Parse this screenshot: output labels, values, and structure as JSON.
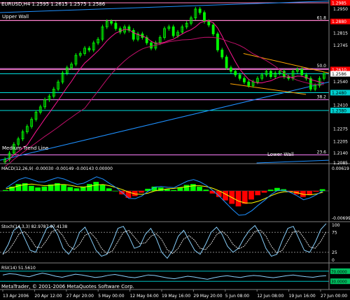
{
  "header": {
    "symbol_line": "EURUSD,H4  1.2595  1.2615  1.2575  1.2586"
  },
  "footer": {
    "copyright": "MetaTrader, © 2001-2006 MetaQuotes Software Corp."
  },
  "colors": {
    "background": "#000000",
    "up_bar": "#00ff00",
    "fib_line": "#ff80ff",
    "channel_line": "#1e90ff",
    "price_badge": "#ff0000",
    "level_badge": "#00d0d0",
    "orange_line": "#ffa500",
    "ma_line": "#ff1493",
    "macd_histogram_up": "#00ff00",
    "macd_histogram_down": "#ff0000",
    "macd_signal": "#ffff00",
    "macd_line": "#1e90ff",
    "stoch_line": "#87cefa",
    "rsi_line": "#87cefa"
  },
  "chart_data": [
    {
      "type": "candlestick",
      "name": "EURUSD,H4",
      "ylim": [
        1.2085,
        1.2985
      ],
      "price_axis_labels": [
        "1.2985",
        "1.2950",
        "1.2880",
        "1.2815",
        "1.2745",
        "1.2610",
        "1.2586",
        "1.2540",
        "1.2480",
        "1.2410",
        "1.2380",
        "1.2275",
        "1.2205",
        "1.2140",
        "1.2085"
      ],
      "highlighted_prices": [
        {
          "value": "1.2985",
          "style": "price"
        },
        {
          "value": "1.2880",
          "style": "price"
        },
        {
          "value": "1.2610",
          "style": "price"
        },
        {
          "value": "1.2586",
          "style": "current"
        },
        {
          "value": "1.2480",
          "style": "level"
        },
        {
          "value": "1.2380",
          "style": "level"
        }
      ],
      "fib_levels": [
        {
          "label": "61.8",
          "price": 1.2885
        },
        {
          "label": "50.0",
          "price": 1.2615
        },
        {
          "label": "38.2",
          "price": 1.244
        },
        {
          "label": "23.6",
          "price": 1.213
        }
      ],
      "horizontal_levels": [
        1.2985,
        1.2886,
        1.261,
        1.2586,
        1.248,
        1.238
      ],
      "annotations": [
        "Upper Wall",
        "Medium Trend Line",
        "Lower Wall"
      ],
      "close_path": [
        1.2105,
        1.214,
        1.219,
        1.222,
        1.226,
        1.229,
        1.233,
        1.237,
        1.24,
        1.244,
        1.246,
        1.25,
        1.254,
        1.259,
        1.262,
        1.264,
        1.269,
        1.27,
        1.273,
        1.272,
        1.276,
        1.278,
        1.285,
        1.288,
        1.287,
        1.284,
        1.282,
        1.285,
        1.283,
        1.278,
        1.281,
        1.279,
        1.276,
        1.273,
        1.276,
        1.279,
        1.284,
        1.285,
        1.28,
        1.282,
        1.285,
        1.287,
        1.29,
        1.295,
        1.293,
        1.288,
        1.286,
        1.281,
        1.272,
        1.268,
        1.262,
        1.26,
        1.258,
        1.256,
        1.254,
        1.252,
        1.254,
        1.256,
        1.258,
        1.26,
        1.257,
        1.259,
        1.26,
        1.257,
        1.256,
        1.26,
        1.261,
        1.258,
        1.256,
        1.25,
        1.252,
        1.256,
        1.2586
      ]
    },
    {
      "type": "bar",
      "name": "MACD",
      "label": "MACD(12,26,9) -0.00030 -0.00149 -0.00143 0.00000",
      "axis_labels": [
        "0.00619",
        "-0.00699"
      ],
      "histogram": [
        0.0002,
        0.001,
        0.0016,
        0.0018,
        0.0012,
        0.0008,
        0.001,
        0.0015,
        0.0018,
        0.0014,
        0.0009,
        0.0006,
        0.001,
        0.0016,
        0.0021,
        0.0014,
        0.0006,
        0.0,
        -0.0008,
        -0.0016,
        -0.0012,
        -0.0004,
        0.0005,
        0.001,
        0.0008,
        0.0004,
        0.0002,
        0.0008,
        0.0014,
        0.0016,
        0.001,
        0.0003,
        -0.0006,
        -0.0014,
        -0.0022,
        -0.003,
        -0.0036,
        -0.003,
        -0.002,
        -0.001,
        -0.0004,
        0.0003,
        0.0007,
        0.0004,
        -0.0002,
        -0.0008,
        -0.0014,
        -0.0008,
        -0.0002,
        0.0004
      ],
      "signal": [
        0.0005,
        0.0008,
        0.0012,
        0.0015,
        0.0016,
        0.0014,
        0.0012,
        0.0013,
        0.0015,
        0.0015,
        0.0013,
        0.001,
        0.0009,
        0.0011,
        0.0014,
        0.0015,
        0.0012,
        0.0008,
        0.0003,
        -0.0003,
        -0.0007,
        -0.0008,
        -0.0005,
        0.0,
        0.0003,
        0.0005,
        0.0006,
        0.0008,
        0.001,
        0.0012,
        0.0012,
        0.001,
        0.0006,
        0.0,
        -0.0008,
        -0.0016,
        -0.0024,
        -0.0028,
        -0.0028,
        -0.0024,
        -0.0018,
        -0.0011,
        -0.0005,
        -0.0002,
        -0.0002,
        -0.0004,
        -0.0008,
        -0.0009,
        -0.0007,
        -0.0003
      ]
    },
    {
      "type": "line",
      "name": "Stoch",
      "label": "Stoch(14,3,3) 82.9787 97.4138",
      "axis_labels": [
        "100",
        "75",
        "25",
        "0"
      ],
      "ylim": [
        0,
        100
      ],
      "values": [
        20,
        45,
        80,
        90,
        60,
        30,
        25,
        55,
        85,
        92,
        70,
        35,
        20,
        40,
        75,
        88,
        60,
        30,
        15,
        20,
        50,
        85,
        90,
        65,
        35,
        40,
        70,
        85,
        60,
        25,
        10,
        30,
        65,
        80,
        55,
        30,
        20,
        45,
        75,
        88,
        70,
        40,
        25,
        35,
        60,
        80,
        92,
        70,
        35,
        15,
        20,
        55,
        85,
        90,
        60,
        30,
        25,
        50,
        82,
        97
      ]
    },
    {
      "type": "line",
      "name": "RSI",
      "label": "RSI(14) 51.5610",
      "axis_labels": [
        "70.0000",
        "30.0000"
      ],
      "ylim": [
        0,
        100
      ],
      "values": [
        55,
        60,
        58,
        52,
        48,
        56,
        62,
        57,
        50,
        46,
        52,
        58,
        55,
        50,
        45,
        48,
        54,
        57,
        52,
        47,
        44,
        49,
        55,
        53,
        48,
        43,
        40,
        45,
        50,
        47,
        42,
        38,
        44,
        49,
        52,
        48,
        45,
        50,
        53,
        51,
        47,
        44,
        48,
        52,
        55,
        51,
        48,
        46,
        50,
        52
      ]
    }
  ],
  "time_axis": [
    "13 Apr 2006",
    "20 Apr 12:00",
    "27 Apr 20:00",
    "5 May 00:00",
    "12 May 04:00",
    "19 May 16:00",
    "29 May 20:00",
    "5 Jun 08:00",
    "12 Jun 08:00",
    "19 Jun 16:00",
    "27 Jun 00:00"
  ]
}
